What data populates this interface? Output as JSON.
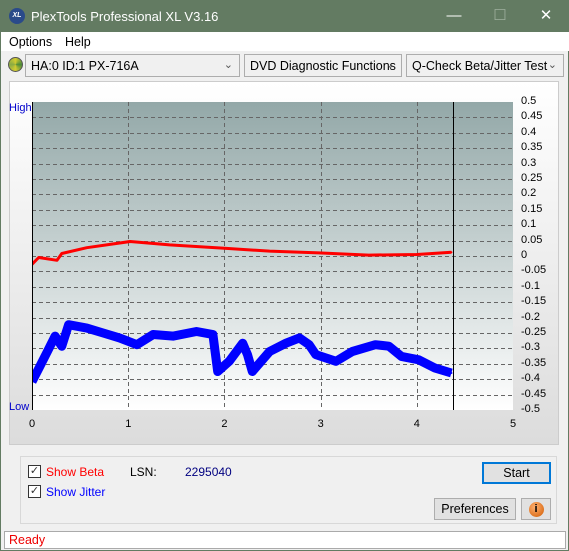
{
  "window": {
    "title": "PlexTools Professional XL V3.16",
    "logo": "XL"
  },
  "menu": [
    "Options",
    "Help"
  ],
  "toolbar": {
    "drive": "HA:0 ID:1  PX-716A",
    "category": "DVD Diagnostic Functions",
    "test": "Q-Check Beta/Jitter Test"
  },
  "chart_data": {
    "type": "line",
    "xlim": [
      0,
      5
    ],
    "ylim": [
      -0.5,
      0.5
    ],
    "x_ticks": [
      "0",
      "1",
      "2",
      "3",
      "4",
      "5"
    ],
    "y_ticks": [
      "0.5",
      "0.45",
      "0.4",
      "0.35",
      "0.3",
      "0.25",
      "0.2",
      "0.15",
      "0.1",
      "0.05",
      "0",
      "-0.05",
      "-0.1",
      "-0.15",
      "-0.2",
      "-0.25",
      "-0.3",
      "-0.35",
      "-0.4",
      "-0.45",
      "-0.5"
    ],
    "left_labels": {
      "top": "High",
      "bottom": "Low"
    },
    "grid": true,
    "end_marker_x": 4.38,
    "series": [
      {
        "key": "beta",
        "color": "#ff0000",
        "points": [
          [
            0,
            -0.027
          ],
          [
            0.07,
            -0.005
          ],
          [
            0.26,
            -0.014
          ],
          [
            0.31,
            0.008
          ],
          [
            0.57,
            0.027
          ],
          [
            1.02,
            0.047
          ],
          [
            1.43,
            0.036
          ],
          [
            2.0,
            0.025
          ],
          [
            2.47,
            0.016
          ],
          [
            2.98,
            0.01
          ],
          [
            3.5,
            0.003
          ],
          [
            4.0,
            0.005
          ],
          [
            4.36,
            0.012
          ]
        ]
      },
      {
        "key": "jitter",
        "color": "#0000ff",
        "points": [
          [
            0,
            -0.408
          ],
          [
            0.09,
            -0.353
          ],
          [
            0.16,
            -0.31
          ],
          [
            0.24,
            -0.26
          ],
          [
            0.31,
            -0.293
          ],
          [
            0.38,
            -0.223
          ],
          [
            0.57,
            -0.234
          ],
          [
            0.74,
            -0.25
          ],
          [
            0.91,
            -0.266
          ],
          [
            1.09,
            -0.288
          ],
          [
            1.26,
            -0.255
          ],
          [
            1.47,
            -0.26
          ],
          [
            1.71,
            -0.245
          ],
          [
            1.88,
            -0.255
          ],
          [
            1.93,
            -0.375
          ],
          [
            2.05,
            -0.342
          ],
          [
            2.19,
            -0.283
          ],
          [
            2.24,
            -0.32
          ],
          [
            2.29,
            -0.375
          ],
          [
            2.47,
            -0.31
          ],
          [
            2.64,
            -0.283
          ],
          [
            2.78,
            -0.266
          ],
          [
            2.88,
            -0.288
          ],
          [
            2.95,
            -0.32
          ],
          [
            3.16,
            -0.342
          ],
          [
            3.33,
            -0.31
          ],
          [
            3.57,
            -0.288
          ],
          [
            3.71,
            -0.293
          ],
          [
            3.84,
            -0.326
          ],
          [
            4.02,
            -0.337
          ],
          [
            4.19,
            -0.364
          ],
          [
            4.36,
            -0.38
          ]
        ]
      }
    ]
  },
  "controls": {
    "show_beta": "Show Beta",
    "show_jitter": "Show Jitter",
    "beta_checked": true,
    "jitter_checked": true,
    "lsn_label": "LSN:",
    "lsn_value": "2295040",
    "start": "Start",
    "preferences": "Preferences",
    "info_icon": "info-icon"
  },
  "status": "Ready"
}
